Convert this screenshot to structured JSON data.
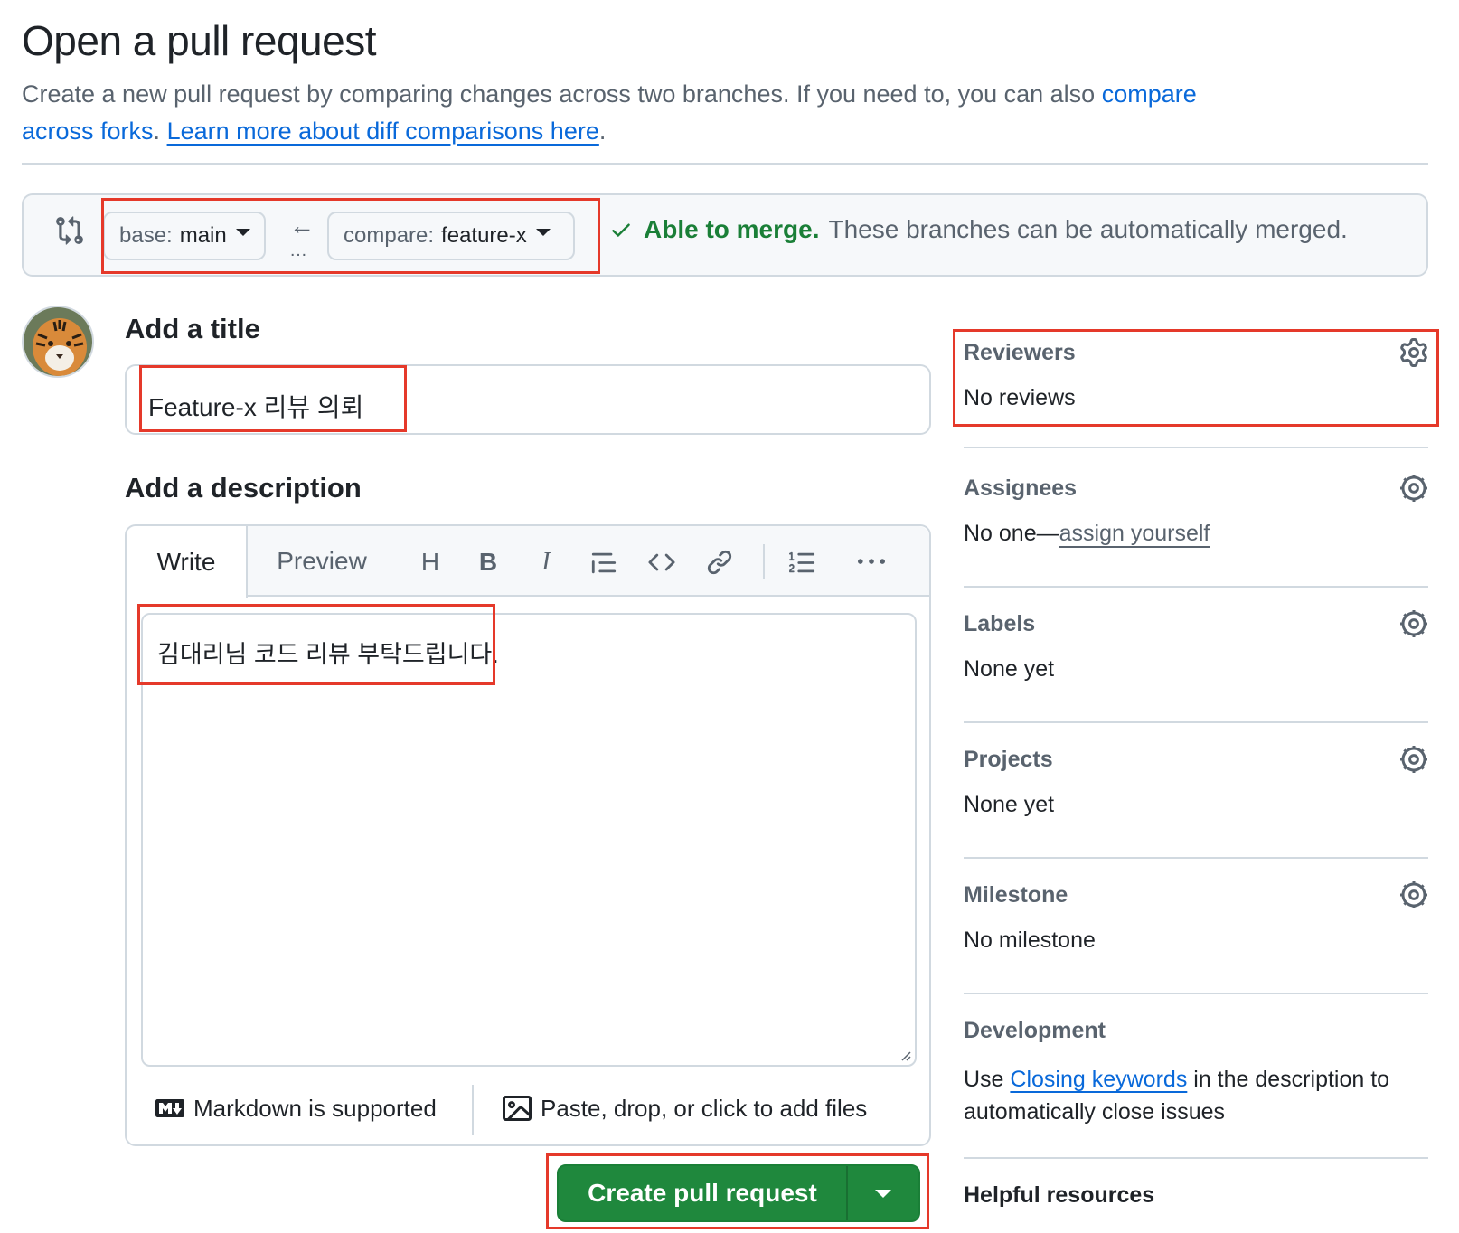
{
  "page": {
    "title": "Open a pull request",
    "intro_text": "Create a new pull request by comparing changes across two branches. If you need to, you can also ",
    "compare_forks_link": "compare across forks",
    "intro_sep": ". ",
    "learn_more_link": "Learn more about diff comparisons here",
    "intro_end": "."
  },
  "compare": {
    "base_prefix": "base:",
    "base_branch": "main",
    "compare_prefix": "compare:",
    "compare_branch": "feature-x",
    "arrow": "←",
    "dots": "…",
    "merge_ok": "Able to merge.",
    "merge_msg": "These branches can be automatically merged."
  },
  "form": {
    "title_heading": "Add a title",
    "title_value": "Feature-x 리뷰 의뢰",
    "description_heading": "Add a description",
    "tab_write": "Write",
    "tab_preview": "Preview",
    "description_value": "김대리님 코드 리뷰 부탁드립니다.",
    "markdown_note": "Markdown is supported",
    "files_note": "Paste, drop, or click to add files",
    "submit_label": "Create pull request"
  },
  "toolbar": {
    "heading": "H",
    "bold": "B",
    "italic": "I"
  },
  "sidebar": {
    "reviewers": {
      "label": "Reviewers",
      "value": "No reviews"
    },
    "assignees": {
      "label": "Assignees",
      "value_prefix": "No one—",
      "link": "assign yourself"
    },
    "labels": {
      "label": "Labels",
      "value": "None yet"
    },
    "projects": {
      "label": "Projects",
      "value": "None yet"
    },
    "milestone": {
      "label": "Milestone",
      "value": "No milestone"
    },
    "development": {
      "label": "Development",
      "text_prefix": "Use ",
      "link": "Closing keywords",
      "text_suffix": " in the description to automatically close issues"
    },
    "helpful_resources": "Helpful resources"
  },
  "colors": {
    "accent_blue": "#0969da",
    "merge_green": "#1a7f37",
    "button_green": "#1f883d",
    "highlight_red": "#e5392a"
  }
}
